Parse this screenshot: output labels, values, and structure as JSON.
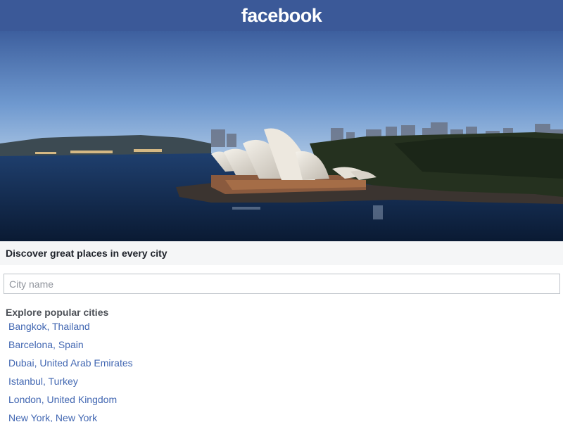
{
  "header": {
    "logo_text": "facebook",
    "background_color": "#3b5998"
  },
  "hero": {
    "image_subject": "sydney-opera-house-harbour-photo"
  },
  "discover": {
    "heading": "Discover great places in every city"
  },
  "search": {
    "placeholder": "City name",
    "value": ""
  },
  "explore": {
    "heading": "Explore popular cities",
    "cities": [
      {
        "label": "Bangkok, Thailand"
      },
      {
        "label": "Barcelona, Spain"
      },
      {
        "label": "Dubai, United Arab Emirates"
      },
      {
        "label": "Istanbul, Turkey"
      },
      {
        "label": "London, United Kingdom"
      },
      {
        "label": "New York, New York"
      }
    ]
  },
  "colors": {
    "brand": "#3b5998",
    "link": "#4267b2",
    "text": "#1d2129",
    "subheading": "#4b4f56"
  }
}
